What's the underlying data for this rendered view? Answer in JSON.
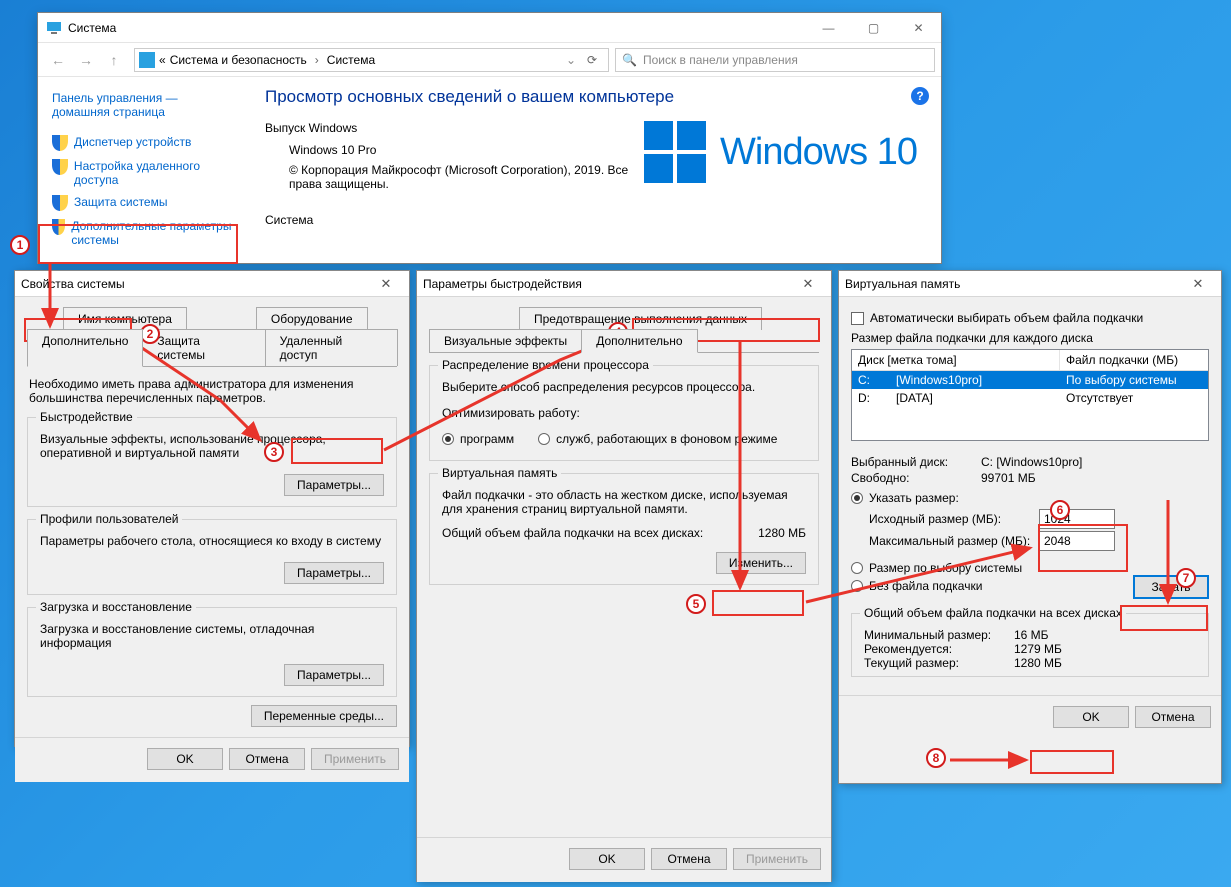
{
  "annotations": [
    "1",
    "2",
    "3",
    "4",
    "5",
    "6",
    "7",
    "8"
  ],
  "system_window": {
    "title": "Система",
    "breadcrumb_pre": "«",
    "breadcrumb1": "Система и безопасность",
    "breadcrumb2": "Система",
    "search_placeholder": "Поиск в панели управления",
    "sidebar": {
      "home_line1": "Панель управления —",
      "home_line2": "домашняя страница",
      "items": [
        "Диспетчер устройств",
        "Настройка удаленного доступа",
        "Защита системы",
        "Дополнительные параметры системы"
      ]
    },
    "main_heading": "Просмотр основных сведений о вашем компьютере",
    "section_release": "Выпуск Windows",
    "edition": "Windows 10 Pro",
    "copyright": "© Корпорация Майкрософт (Microsoft Corporation), 2019. Все права защищены.",
    "section_system": "Система",
    "brand_text": "Windows 10"
  },
  "sysprops": {
    "title": "Свойства системы",
    "tabs_top": [
      "Имя компьютера",
      "Оборудование"
    ],
    "tabs_bottom": [
      "Дополнительно",
      "Защита системы",
      "Удаленный доступ"
    ],
    "intro": "Необходимо иметь права администратора для изменения большинства перечисленных параметров.",
    "perf": {
      "legend": "Быстродействие",
      "desc": "Визуальные эффекты, использование процессора, оперативной и виртуальной памяти",
      "btn": "Параметры..."
    },
    "profiles": {
      "legend": "Профили пользователей",
      "desc": "Параметры рабочего стола, относящиеся ко входу в систему",
      "btn": "Параметры..."
    },
    "startup": {
      "legend": "Загрузка и восстановление",
      "desc": "Загрузка и восстановление системы, отладочная информация",
      "btn": "Параметры..."
    },
    "env_btn": "Переменные среды...",
    "ok": "OK",
    "cancel": "Отмена",
    "apply": "Применить"
  },
  "perfopts": {
    "title": "Параметры быстродействия",
    "tabs": [
      "Визуальные эффекты",
      "Дополнительно",
      "Предотвращение выполнения данных"
    ],
    "cpu": {
      "legend": "Распределение времени процессора",
      "desc": "Выберите способ распределения ресурсов процессора.",
      "optimize_label": "Оптимизировать работу:",
      "opt1": "программ",
      "opt2": "служб, работающих в фоновом режиме"
    },
    "vm": {
      "legend": "Виртуальная память",
      "desc": "Файл подкачки - это область на жестком диске, используемая для хранения страниц виртуальной памяти.",
      "total_label": "Общий объем файла подкачки на всех дисках:",
      "total_value": "1280 МБ",
      "btn": "Изменить..."
    },
    "ok": "OK",
    "cancel": "Отмена",
    "apply": "Применить"
  },
  "vmem": {
    "title": "Виртуальная память",
    "auto_label": "Автоматически выбирать объем файла подкачки",
    "pf_label": "Размер файла подкачки для каждого диска",
    "list_head": [
      "Диск [метка тома]",
      "Файл подкачки (МБ)"
    ],
    "rows": [
      {
        "drive": "C:",
        "label": "[Windows10pro]",
        "pf": "По выбору системы"
      },
      {
        "drive": "D:",
        "label": "[DATA]",
        "pf": "Отсутствует"
      }
    ],
    "selected_label": "Выбранный диск:",
    "selected_value": "C: [Windows10pro]",
    "free_label": "Свободно:",
    "free_value": "99701 МБ",
    "custom_radio": "Указать размер:",
    "init_label": "Исходный размер (МБ):",
    "init_value": "1024",
    "max_label": "Максимальный размер (МБ):",
    "max_value": "2048",
    "sys_radio": "Размер по выбору системы",
    "none_radio": "Без файла подкачки",
    "set_btn": "Задать",
    "total_legend": "Общий объем файла подкачки на всех дисках",
    "min_label": "Минимальный размер:",
    "min_value": "16 МБ",
    "rec_label": "Рекомендуется:",
    "rec_value": "1279 МБ",
    "cur_label": "Текущий размер:",
    "cur_value": "1280 МБ",
    "ok": "OK",
    "cancel": "Отмена"
  }
}
